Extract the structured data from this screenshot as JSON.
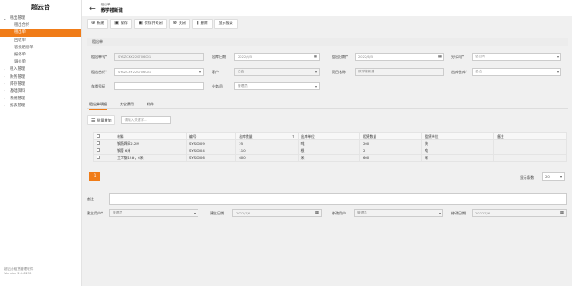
{
  "app": {
    "title": "超云台",
    "footer_name": "超云台租赁管理软件",
    "footer_version": "Version 2.0.6230"
  },
  "sidebar": {
    "items": [
      {
        "label": "租出管理",
        "expanded": true
      },
      {
        "label": "租出合约"
      },
      {
        "label": "租出单",
        "active": true
      },
      {
        "label": "回收单"
      },
      {
        "label": "客损赔偿单"
      },
      {
        "label": "报停单"
      },
      {
        "label": "调价单"
      },
      {
        "label": "租入管理"
      },
      {
        "label": "财务管理"
      },
      {
        "label": "库存管理"
      },
      {
        "label": "基础资料"
      },
      {
        "label": "系统管理"
      },
      {
        "label": "报表管理"
      }
    ]
  },
  "header": {
    "breadcrumb": "租出单",
    "title": "教学楼新建"
  },
  "toolbar": {
    "new": "新建",
    "save": "保存",
    "save_close": "保存并关闭",
    "close": "关闭",
    "delete": "删除",
    "show_report": "显示报表"
  },
  "section_title": "租出单",
  "form": {
    "order_no_label": "租出单号*",
    "order_no": "SYSZCKX220706001",
    "out_date_label": "出库日期",
    "out_date": "2022/6/5",
    "rent_start_label": "租出日期*",
    "rent_start": "2022/6/5",
    "branch_label": "分公司*",
    "branch": "总公司",
    "contract_label": "租出合约*",
    "contract": "SYSZCHY220706001",
    "customer_label": "客户",
    "customer": "白鑫",
    "project_label": "项目名称",
    "project": "教学楼新建",
    "warehouse_label": "出库仓库*",
    "warehouse": "总仓",
    "vehicle_label": "车牌号码",
    "vehicle": "",
    "salesman_label": "业务员",
    "salesman": "管理员"
  },
  "tabs": {
    "detail": "租出单明细",
    "other_fees": "其它费用",
    "attachments": "附件"
  },
  "detail": {
    "batch_add": "批量增加",
    "search_placeholder": "请输入关键字...",
    "headers": [
      "材料",
      "编号",
      "出库数量",
      "出库单位",
      "租赁数量",
      "租赁单位",
      "备注"
    ],
    "rows": [
      {
        "material": "钢筋焊网2.2M",
        "code": "SYS0009",
        "qty": "25",
        "unit": "吨",
        "rent_qty": "200",
        "rent_unit": "块",
        "note": ""
      },
      {
        "material": "钢管 6米",
        "code": "SYS0004",
        "qty": "110",
        "unit": "根",
        "rent_qty": "2",
        "rent_unit": "吨",
        "note": ""
      },
      {
        "material": "工字钢12#，6米",
        "code": "SYS0006",
        "qty": "600",
        "unit": "米",
        "rent_qty": "600",
        "rent_unit": "米",
        "note": ""
      }
    ],
    "page_current": "1",
    "page_size_label": "显示条数:",
    "page_size": "20"
  },
  "footer_form": {
    "remarks_label": "备注",
    "remarks": "",
    "creator_label": "建立用户*",
    "creator": "管理员",
    "created_label": "建立日期",
    "created": "2022/7/6",
    "modifier_label": "修改用户",
    "modifier": "管理员",
    "modified_label": "修改日期",
    "modified": "2022/7/6"
  }
}
